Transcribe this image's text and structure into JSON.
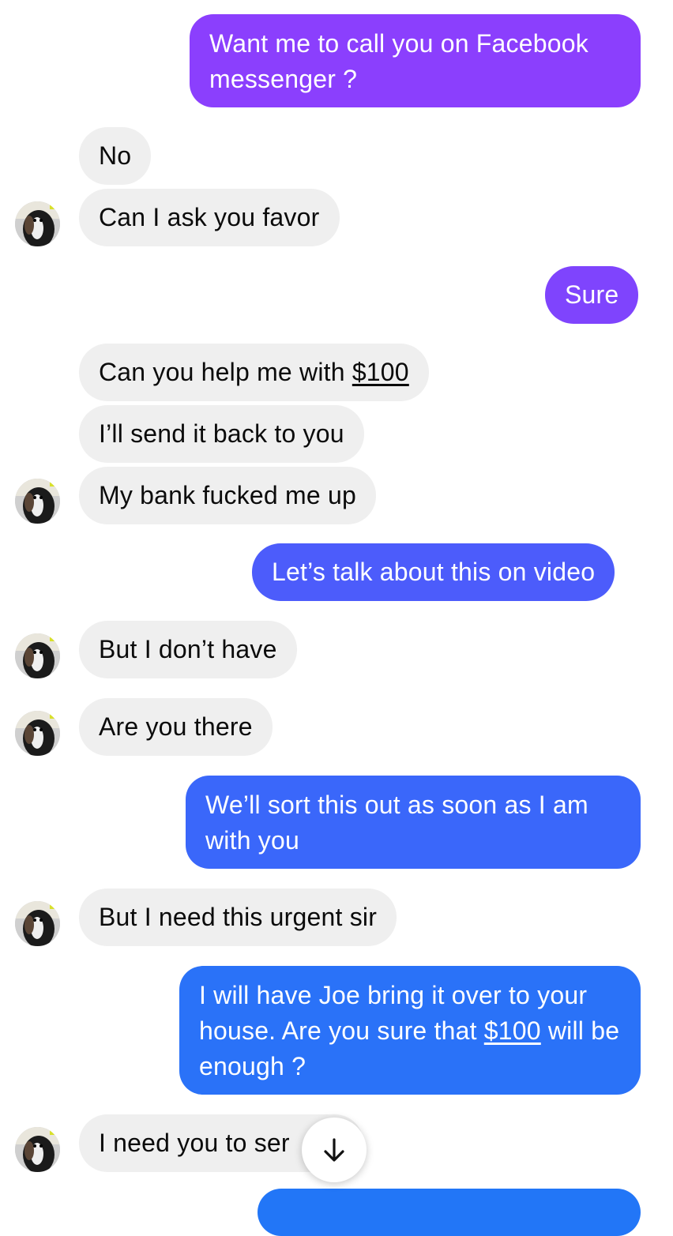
{
  "conversation": {
    "messages": [
      {
        "from": "me",
        "text": "Want me to call you on Facebook messenger ?"
      },
      {
        "from": "them",
        "text": "No"
      },
      {
        "from": "them",
        "text": "Can I ask you favor"
      },
      {
        "from": "me",
        "text": "Sure"
      },
      {
        "from": "them",
        "text_before": "Can you help me with ",
        "link": "$100"
      },
      {
        "from": "them",
        "text": "I’ll send it back to you"
      },
      {
        "from": "them",
        "text": "My bank fucked me up"
      },
      {
        "from": "me",
        "text": "Let’s talk about this on video"
      },
      {
        "from": "them",
        "text": "But I don’t have"
      },
      {
        "from": "them",
        "text": "Are you there"
      },
      {
        "from": "me",
        "text": "We’ll sort this out as soon as I am with you"
      },
      {
        "from": "them",
        "text": "But I need this urgent sir"
      },
      {
        "from": "me",
        "text_before": "I will have Joe bring it over to your house. Are you sure that ",
        "link": "$100",
        "text_after": " will be enough ?"
      },
      {
        "from": "them",
        "text": "I need you to ser"
      }
    ]
  },
  "scroll_button": {
    "icon": "arrow-down-icon"
  },
  "colors": {
    "incoming_bubble": "#efefef",
    "outgoing_purple": "#8a3ffc",
    "outgoing_blue": "#2276f7",
    "text_dark": "#0b0b0b"
  }
}
